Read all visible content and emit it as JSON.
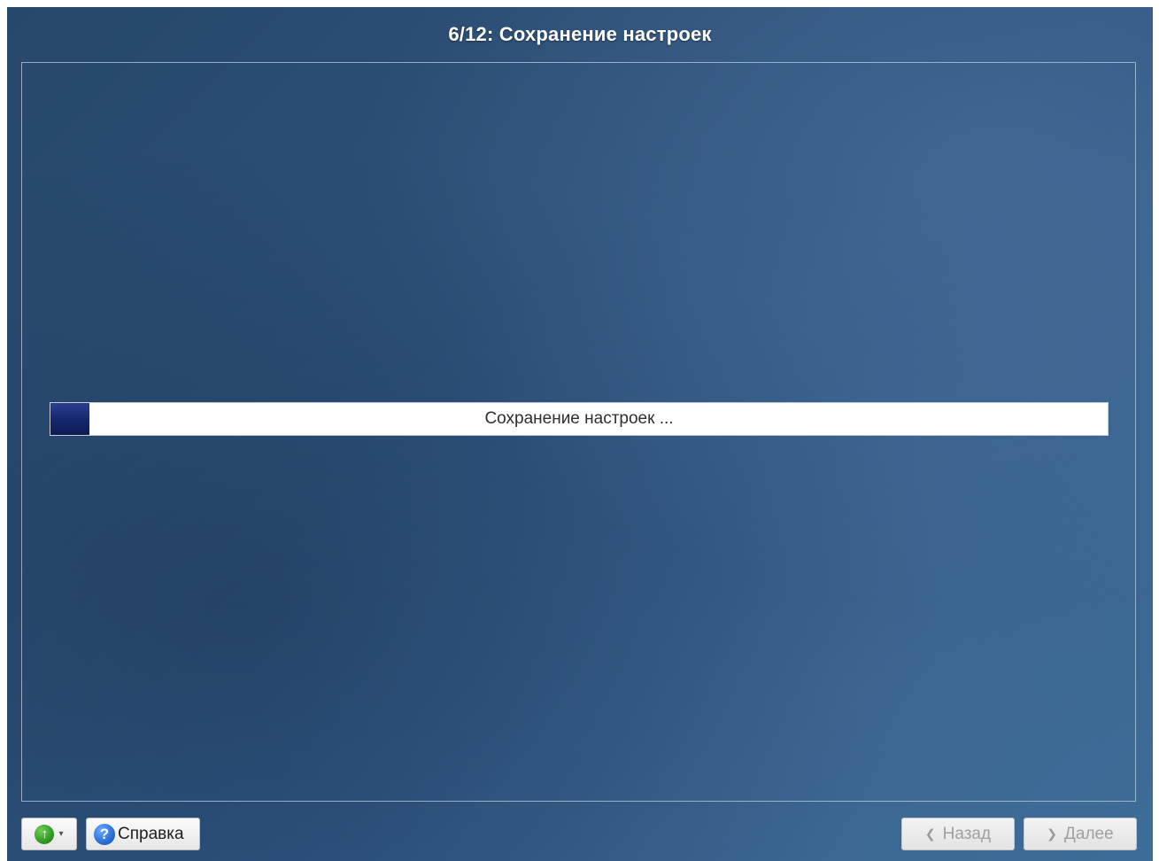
{
  "window": {
    "title": "6/12: Сохранение настроек"
  },
  "progress": {
    "label": "Сохранение настроек ...",
    "fraction": 0.037
  },
  "footer": {
    "up_icon": "green-up-arrow-icon",
    "help_icon": "help-question-icon",
    "help_label": "Справка",
    "back_label": "Назад",
    "next_label": "Далее"
  },
  "colors": {
    "background": "#2d5078",
    "progress_fill": "#16266b",
    "title_text": "#ffffff"
  }
}
